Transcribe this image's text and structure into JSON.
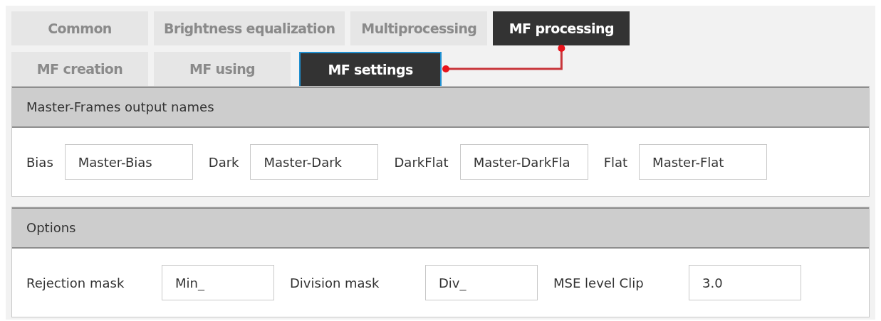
{
  "tab_rows": [
    [
      {
        "label": "Common",
        "selected": false
      },
      {
        "label": "Brightness equalization",
        "selected": false
      },
      {
        "label": "Multiprocessing",
        "selected": false
      },
      {
        "label": "MF processing",
        "selected": true
      }
    ],
    [
      {
        "label": "MF creation",
        "selected": false
      },
      {
        "label": "MF using",
        "selected": false
      },
      {
        "label": "MF settings",
        "selected": true
      }
    ]
  ],
  "sections": [
    {
      "title": "Master-Frames output names",
      "fields": [
        {
          "label": "Bias",
          "value": "Master-Bias"
        },
        {
          "label": "Dark",
          "value": "Master-Dark"
        },
        {
          "label": "DarkFlat",
          "value": "Master-DarkFla"
        },
        {
          "label": "Flat",
          "value": "Master-Flat"
        }
      ]
    },
    {
      "title": "Options",
      "fields": [
        {
          "label": "Rejection mask",
          "value": "Min_"
        },
        {
          "label": "Division mask",
          "value": "Div_"
        },
        {
          "label": "MSE level Clip",
          "value": "3.0"
        }
      ]
    }
  ]
}
